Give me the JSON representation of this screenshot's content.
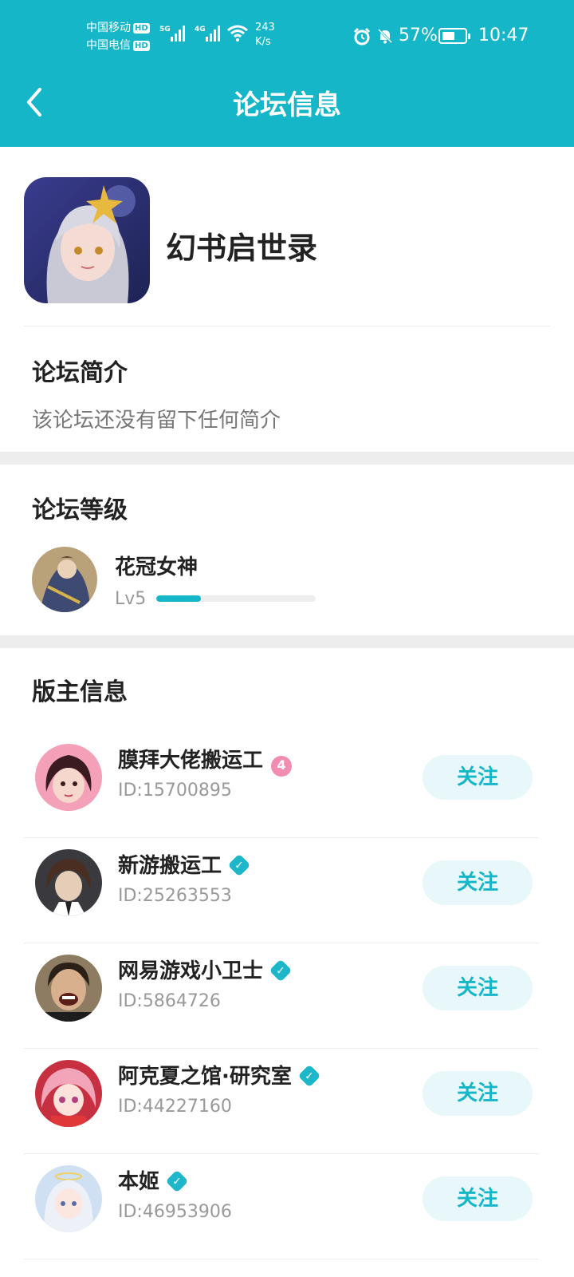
{
  "status_bar": {
    "carrier1": "中国移动",
    "carrier2": "中国电信",
    "hd": "HD",
    "net1": "5G",
    "net2": "4G",
    "speed_value": "243",
    "speed_unit": "K/s",
    "battery_pct": "57%",
    "battery_level": 0.57,
    "time": "10:47"
  },
  "header": {
    "title": "论坛信息"
  },
  "forum": {
    "name": "幻书启世录"
  },
  "intro": {
    "title": "论坛简介",
    "text": "该论坛还没有留下任何简介"
  },
  "level": {
    "title": "论坛等级",
    "name": "花冠女神",
    "lv": "Lv5",
    "progress": 0.28
  },
  "moderators": {
    "title": "版主信息",
    "follow_label": "关注",
    "items": [
      {
        "name": "膜拜大佬搬运工",
        "badge": "level",
        "badge_text": "4",
        "uid": "ID:15700895"
      },
      {
        "name": "新游搬运工",
        "badge": "verified",
        "badge_text": "✓",
        "uid": "ID:25263553"
      },
      {
        "name": "网易游戏小卫士",
        "badge": "verified",
        "badge_text": "✓",
        "uid": "ID:5864726"
      },
      {
        "name": "阿克夏之馆·研究室",
        "badge": "verified",
        "badge_text": "✓",
        "uid": "ID:44227160"
      },
      {
        "name": "本姬",
        "badge": "verified",
        "badge_text": "✓",
        "uid": "ID:46953906"
      }
    ]
  },
  "colors": {
    "accent": "#16b6c9",
    "follow_bg": "#e8f7f9"
  }
}
